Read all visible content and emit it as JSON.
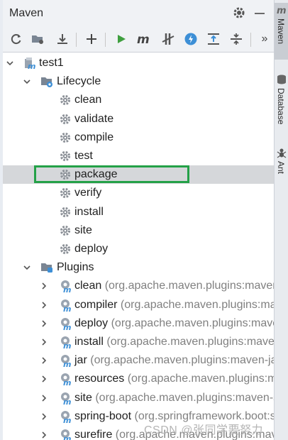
{
  "header": {
    "title": "Maven"
  },
  "toolbar": {
    "buttons": [
      "reload-icon",
      "folder-add-icon",
      "download-icon",
      "add-icon",
      "run-icon",
      "maven-goal-icon",
      "skip-tests-icon",
      "offline-icon",
      "collapse-vertical-icon",
      "expand-vertical-icon",
      "more-icon"
    ],
    "more_label": "»"
  },
  "tree": {
    "project": "test1",
    "lifecycle": {
      "label": "Lifecycle",
      "goals": [
        "clean",
        "validate",
        "compile",
        "test",
        "package",
        "verify",
        "install",
        "site",
        "deploy"
      ],
      "selected": "package"
    },
    "plugins": {
      "label": "Plugins",
      "items": [
        {
          "name": "clean",
          "desc": "(org.apache.maven.plugins:maven-clean-plugin:"
        },
        {
          "name": "compiler",
          "desc": "(org.apache.maven.plugins:maven-compiler-plug"
        },
        {
          "name": "deploy",
          "desc": "(org.apache.maven.plugins:maven-deploy-plugin:"
        },
        {
          "name": "install",
          "desc": "(org.apache.maven.plugins:maven-install-plugin:"
        },
        {
          "name": "jar",
          "desc": "(org.apache.maven.plugins:maven-jar-plugin:"
        },
        {
          "name": "resources",
          "desc": "(org.apache.maven.plugins:maven-resources-plugin"
        },
        {
          "name": "site",
          "desc": "(org.apache.maven.plugins:maven-site-plugin:"
        },
        {
          "name": "spring-boot",
          "desc": "(org.springframework.boot:spring-boot-maven"
        },
        {
          "name": "surefire",
          "desc": "(org.apache.maven.plugins:maven-surefire"
        }
      ]
    }
  },
  "side_tabs": [
    "Maven",
    "Database",
    "Ant"
  ],
  "watermark": "CSDN @张同学要努力",
  "colors": {
    "highlight": "#24a148",
    "selected_row": "#d5d7da",
    "run_green": "#3f9f3f",
    "accent_blue": "#3d8fd6"
  }
}
